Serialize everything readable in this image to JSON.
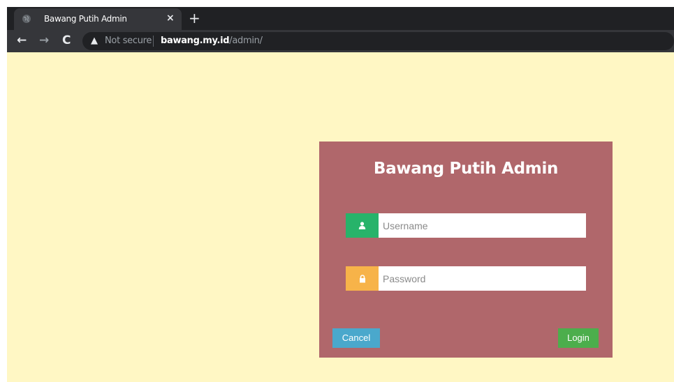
{
  "browser": {
    "tab_title": "Bawang Putih Admin",
    "tab_close": "×",
    "new_tab": "+",
    "back": "←",
    "forward": "→",
    "reload": "C",
    "security_icon": "▲",
    "security_label": "Not secure",
    "url_host": "bawang.my.id",
    "url_path": "/admin/"
  },
  "login": {
    "title": "Bawang Putih Admin",
    "username_placeholder": "Username",
    "username_value": "",
    "password_placeholder": "Password",
    "password_value": "",
    "cancel_label": "Cancel",
    "login_label": "Login"
  },
  "icons": {
    "user": "user-icon",
    "lock": "lock-icon",
    "globe": "globe-icon"
  },
  "colors": {
    "page_background": "#fff7c4",
    "panel": "#b0676b",
    "user_addon": "#27b36a",
    "password_addon": "#f7b349",
    "cancel_button": "#4aa8cc",
    "login_button": "#4cae4c"
  }
}
